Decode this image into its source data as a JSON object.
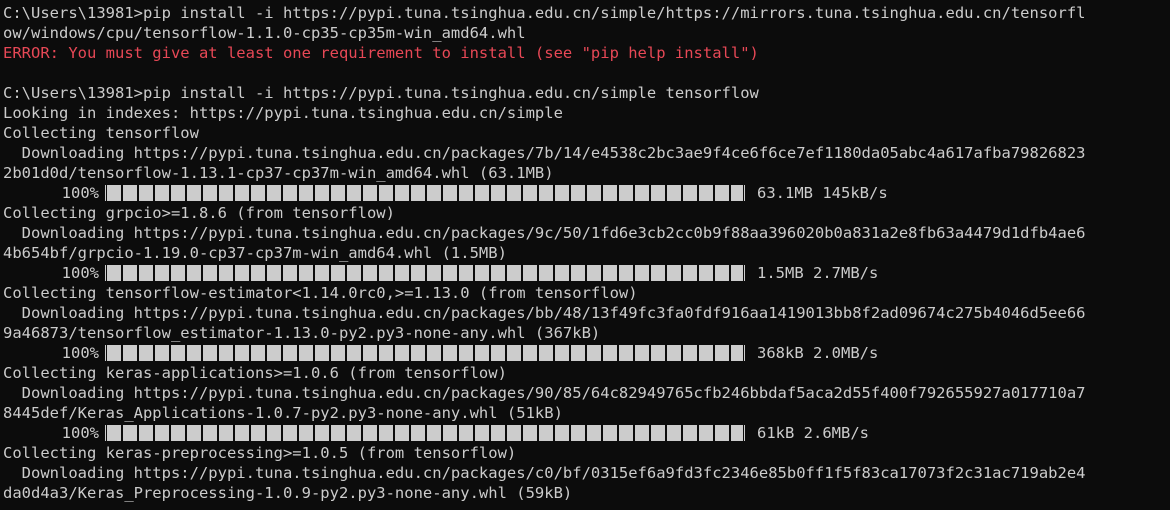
{
  "lines": [
    {
      "type": "text",
      "text": "C:\\Users\\13981>pip install -i https://pypi.tuna.tsinghua.edu.cn/simple/https://mirrors.tuna.tsinghua.edu.cn/tensorfl"
    },
    {
      "type": "text",
      "text": "ow/windows/cpu/tensorflow-1.1.0-cp35-cp35m-win_amd64.whl"
    },
    {
      "type": "error",
      "text": "ERROR: You must give at least one requirement to install (see \"pip help install\")"
    },
    {
      "type": "blank",
      "text": ""
    },
    {
      "type": "text",
      "text": "C:\\Users\\13981>pip install -i https://pypi.tuna.tsinghua.edu.cn/simple tensorflow"
    },
    {
      "type": "text",
      "text": "Looking in indexes: https://pypi.tuna.tsinghua.edu.cn/simple"
    },
    {
      "type": "text",
      "text": "Collecting tensorflow"
    },
    {
      "type": "text",
      "text": "  Downloading https://pypi.tuna.tsinghua.edu.cn/packages/7b/14/e4538c2bc3ae9f4ce6f6ce7ef1180da05abc4a617afba79826823"
    },
    {
      "type": "text",
      "text": "2b01d0d/tensorflow-1.13.1-cp37-cp37m-win_amd64.whl (63.1MB)"
    },
    {
      "type": "progress",
      "percent": "100%",
      "fill": 1.0,
      "stats": "63.1MB 145kB/s"
    },
    {
      "type": "text",
      "text": "Collecting grpcio>=1.8.6 (from tensorflow)"
    },
    {
      "type": "text",
      "text": "  Downloading https://pypi.tuna.tsinghua.edu.cn/packages/9c/50/1fd6e3cb2cc0b9f88aa396020b0a831a2e8fb63a4479d1dfb4ae6"
    },
    {
      "type": "text",
      "text": "4b654bf/grpcio-1.19.0-cp37-cp37m-win_amd64.whl (1.5MB)"
    },
    {
      "type": "progress",
      "percent": "100%",
      "fill": 1.0,
      "stats": "1.5MB 2.7MB/s"
    },
    {
      "type": "text",
      "text": "Collecting tensorflow-estimator<1.14.0rc0,>=1.13.0 (from tensorflow)"
    },
    {
      "type": "text",
      "text": "  Downloading https://pypi.tuna.tsinghua.edu.cn/packages/bb/48/13f49fc3fa0fdf916aa1419013bb8f2ad09674c275b4046d5ee66"
    },
    {
      "type": "text",
      "text": "9a46873/tensorflow_estimator-1.13.0-py2.py3-none-any.whl (367kB)"
    },
    {
      "type": "progress",
      "percent": "100%",
      "fill": 1.0,
      "stats": "368kB 2.0MB/s"
    },
    {
      "type": "text",
      "text": "Collecting keras-applications>=1.0.6 (from tensorflow)"
    },
    {
      "type": "text",
      "text": "  Downloading https://pypi.tuna.tsinghua.edu.cn/packages/90/85/64c82949765cfb246bbdaf5aca2d55f400f792655927a017710a7"
    },
    {
      "type": "text",
      "text": "8445def/Keras_Applications-1.0.7-py2.py3-none-any.whl (51kB)"
    },
    {
      "type": "progress",
      "percent": "100%",
      "fill": 1.0,
      "stats": "61kB 2.6MB/s"
    },
    {
      "type": "text",
      "text": "Collecting keras-preprocessing>=1.0.5 (from tensorflow)"
    },
    {
      "type": "text",
      "text": "  Downloading https://pypi.tuna.tsinghua.edu.cn/packages/c0/bf/0315ef6a9fd3fc2346e85b0ff1f5f83ca17073f2c31ac719ab2e4"
    },
    {
      "type": "text",
      "text": "da0d4a3/Keras_Preprocessing-1.0.9-py2.py3-none-any.whl (59kB)"
    }
  ],
  "colors": {
    "background": "#0c0c0c",
    "foreground": "#cccccc",
    "error": "#e74856"
  }
}
